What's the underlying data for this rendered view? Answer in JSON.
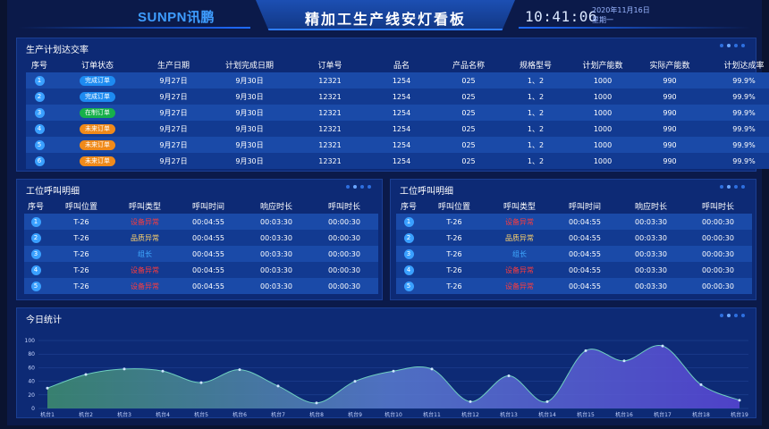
{
  "header": {
    "brand": "SUNPN讯鹏",
    "title": "精加工生产线安灯看板",
    "time": "10:41:06",
    "date": "2020年11月16日",
    "weekday": "星期一"
  },
  "production": {
    "title": "生产计划达交率",
    "columns": [
      "序号",
      "订单状态",
      "生产日期",
      "计划完成日期",
      "订单号",
      "品名",
      "产品名称",
      "规格型号",
      "计划产能数",
      "实际产能数",
      "计划达成率"
    ],
    "rows": [
      {
        "idx": "1",
        "status": "完成订单",
        "status_color": "blue",
        "prod_date": "9月27日",
        "plan_date": "9月30日",
        "order": "12321",
        "item": "1254",
        "product": "025",
        "spec": "1、2",
        "plan_qty": "1000",
        "actual_qty": "990",
        "rate": "99.9%"
      },
      {
        "idx": "2",
        "status": "完成订单",
        "status_color": "blue",
        "prod_date": "9月27日",
        "plan_date": "9月30日",
        "order": "12321",
        "item": "1254",
        "product": "025",
        "spec": "1、2",
        "plan_qty": "1000",
        "actual_qty": "990",
        "rate": "99.9%"
      },
      {
        "idx": "3",
        "status": "在制订单",
        "status_color": "green",
        "prod_date": "9月27日",
        "plan_date": "9月30日",
        "order": "12321",
        "item": "1254",
        "product": "025",
        "spec": "1、2",
        "plan_qty": "1000",
        "actual_qty": "990",
        "rate": "99.9%"
      },
      {
        "idx": "4",
        "status": "未来订单",
        "status_color": "orange",
        "prod_date": "9月27日",
        "plan_date": "9月30日",
        "order": "12321",
        "item": "1254",
        "product": "025",
        "spec": "1、2",
        "plan_qty": "1000",
        "actual_qty": "990",
        "rate": "99.9%"
      },
      {
        "idx": "5",
        "status": "未来订单",
        "status_color": "orange",
        "prod_date": "9月27日",
        "plan_date": "9月30日",
        "order": "12321",
        "item": "1254",
        "product": "025",
        "spec": "1、2",
        "plan_qty": "1000",
        "actual_qty": "990",
        "rate": "99.9%"
      },
      {
        "idx": "6",
        "status": "未来订单",
        "status_color": "orange",
        "prod_date": "9月27日",
        "plan_date": "9月30日",
        "order": "12321",
        "item": "1254",
        "product": "025",
        "spec": "1、2",
        "plan_qty": "1000",
        "actual_qty": "990",
        "rate": "99.9%"
      }
    ]
  },
  "calls_left": {
    "title": "工位呼叫明细",
    "columns": [
      "序号",
      "呼叫位置",
      "呼叫类型",
      "呼叫时间",
      "响应时长",
      "呼叫时长"
    ],
    "rows": [
      {
        "idx": "1",
        "pos": "T-26",
        "type": "设备异常",
        "type_color": "red",
        "time": "00:04:55",
        "resp": "00:03:30",
        "dur": "00:00:30"
      },
      {
        "idx": "2",
        "pos": "T-26",
        "type": "品质异常",
        "type_color": "yellow",
        "time": "00:04:55",
        "resp": "00:03:30",
        "dur": "00:00:30"
      },
      {
        "idx": "3",
        "pos": "T-26",
        "type": "组长",
        "type_color": "blue",
        "time": "00:04:55",
        "resp": "00:03:30",
        "dur": "00:00:30"
      },
      {
        "idx": "4",
        "pos": "T-26",
        "type": "设备异常",
        "type_color": "red",
        "time": "00:04:55",
        "resp": "00:03:30",
        "dur": "00:00:30"
      },
      {
        "idx": "5",
        "pos": "T-26",
        "type": "设备异常",
        "type_color": "red",
        "time": "00:04:55",
        "resp": "00:03:30",
        "dur": "00:00:30"
      }
    ]
  },
  "calls_right": {
    "title": "工位呼叫明细",
    "columns": [
      "序号",
      "呼叫位置",
      "呼叫类型",
      "呼叫时间",
      "响应时长",
      "呼叫时长"
    ],
    "rows": [
      {
        "idx": "1",
        "pos": "T-26",
        "type": "设备异常",
        "type_color": "red",
        "time": "00:04:55",
        "resp": "00:03:30",
        "dur": "00:00:30"
      },
      {
        "idx": "2",
        "pos": "T-26",
        "type": "品质异常",
        "type_color": "yellow",
        "time": "00:04:55",
        "resp": "00:03:30",
        "dur": "00:00:30"
      },
      {
        "idx": "3",
        "pos": "T-26",
        "type": "组长",
        "type_color": "blue",
        "time": "00:04:55",
        "resp": "00:03:30",
        "dur": "00:00:30"
      },
      {
        "idx": "4",
        "pos": "T-26",
        "type": "设备异常",
        "type_color": "red",
        "time": "00:04:55",
        "resp": "00:03:30",
        "dur": "00:00:30"
      },
      {
        "idx": "5",
        "pos": "T-26",
        "type": "设备异常",
        "type_color": "red",
        "time": "00:04:55",
        "resp": "00:03:30",
        "dur": "00:00:30"
      }
    ]
  },
  "today": {
    "title": "今日统计"
  },
  "chart_data": {
    "type": "area",
    "categories": [
      "机台1",
      "机台2",
      "机台3",
      "机台4",
      "机台5",
      "机台6",
      "机台7",
      "机台8",
      "机台9",
      "机台10",
      "机台11",
      "机台12",
      "机台13",
      "机台14",
      "机台15",
      "机台16",
      "机台17",
      "机台18",
      "机台19"
    ],
    "values": [
      30,
      50,
      58,
      55,
      38,
      57,
      33,
      8,
      40,
      55,
      58,
      10,
      48,
      10,
      85,
      70,
      92,
      35,
      12
    ],
    "yticks": [
      "0",
      "20",
      "40",
      "60",
      "80",
      "100"
    ],
    "ylim": [
      0,
      100
    ],
    "gradient": [
      "#3f8f6e",
      "#5a7bd0",
      "#5a46d6"
    ]
  }
}
